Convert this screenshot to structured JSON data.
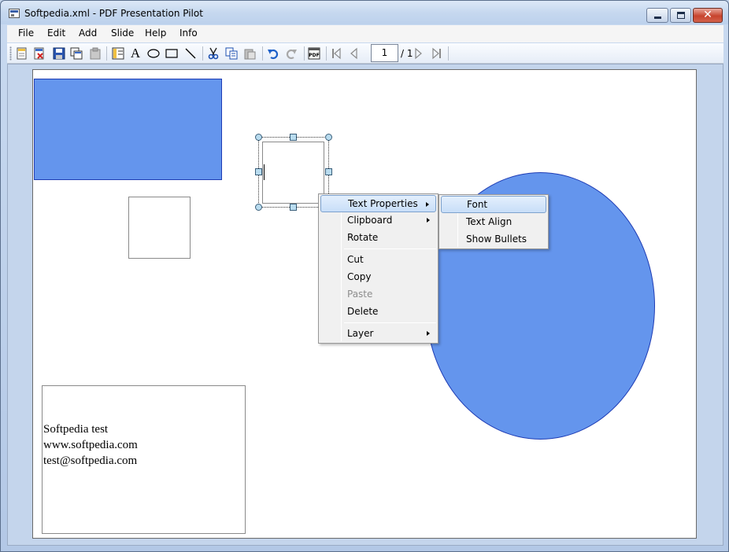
{
  "window": {
    "title": "Softpedia.xml - PDF Presentation Pilot",
    "close_glyph": "✕"
  },
  "menubar": {
    "items": [
      "File",
      "Edit",
      "Add",
      "Slide",
      "Help",
      "Info"
    ]
  },
  "toolbar": {
    "icons": [
      "new-slide-icon",
      "delete-slide-icon",
      "save-icon",
      "duplicate-icon",
      "paste-slide-icon",
      "layout-icon",
      "text-tool-icon",
      "ellipse-tool-icon",
      "rectangle-tool-icon",
      "line-tool-icon",
      "cut-icon",
      "copy-icon",
      "paste-icon",
      "undo-icon",
      "redo-icon",
      "export-pdf-icon",
      "first-page-icon",
      "prev-page-icon",
      "next-page-icon",
      "last-page-icon"
    ],
    "text_tool_glyph": "A",
    "pdf_label": "PDF",
    "page_current": "1",
    "page_total": "/ 1"
  },
  "slide": {
    "text_box_lines": [
      "Softpedia test",
      "www.softpedia.com",
      "test@softpedia.com"
    ]
  },
  "context_menu": {
    "items": [
      {
        "label": "Text Properties",
        "submenu": true,
        "highlighted": true
      },
      {
        "label": "Clipboard",
        "submenu": true
      },
      {
        "label": "Rotate"
      },
      {
        "label": "Cut"
      },
      {
        "label": "Copy"
      },
      {
        "label": "Paste",
        "disabled": true
      },
      {
        "label": "Delete"
      },
      {
        "label": "Layer",
        "submenu": true
      }
    ]
  },
  "submenu": {
    "items": [
      {
        "label": "Font",
        "highlighted": true
      },
      {
        "label": "Text Align"
      },
      {
        "label": "Show Bullets"
      }
    ]
  },
  "colors": {
    "shape_fill": "#6495ed",
    "shape_stroke": "#1e3cb4",
    "menu_highlight": "#c8def8"
  }
}
